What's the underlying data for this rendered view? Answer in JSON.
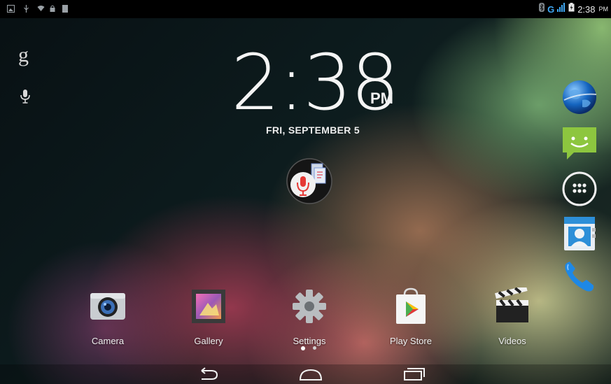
{
  "status_bar": {
    "left_icons": [
      "image-notification-icon",
      "usb-icon",
      "wifi-icon",
      "lock-icon",
      "sd-card-icon"
    ],
    "right_icons": [
      "bluetooth-icon",
      "signal-icon",
      "battery-icon"
    ],
    "network_label": "G",
    "time": "2:38",
    "ampm": "PM"
  },
  "clock": {
    "time": "2:38",
    "ampm": "PM",
    "date": "FRI, SEPTEMBER 5"
  },
  "search": {
    "google_glyph": "g",
    "voice_icon": "microphone-icon"
  },
  "dock": [
    {
      "name": "browser",
      "icon": "globe-icon"
    },
    {
      "name": "messaging",
      "icon": "message-icon"
    },
    {
      "name": "all-apps",
      "icon": "app-drawer-icon"
    },
    {
      "name": "people",
      "icon": "contacts-icon"
    },
    {
      "name": "phone",
      "icon": "phone-icon"
    }
  ],
  "apps": [
    {
      "label": "Camera",
      "icon": "camera-icon"
    },
    {
      "label": "Gallery",
      "icon": "gallery-icon"
    },
    {
      "label": "Settings",
      "icon": "settings-gear-icon"
    },
    {
      "label": "Play Store",
      "icon": "play-store-icon"
    },
    {
      "label": "Videos",
      "icon": "clapperboard-icon"
    }
  ],
  "nav": [
    "back-icon",
    "home-icon",
    "recents-icon"
  ],
  "colors": {
    "status_bar": "#000000",
    "message_green": "#8dc63f",
    "phone_blue": "#1e88e5",
    "voice_red": "#e53935"
  }
}
